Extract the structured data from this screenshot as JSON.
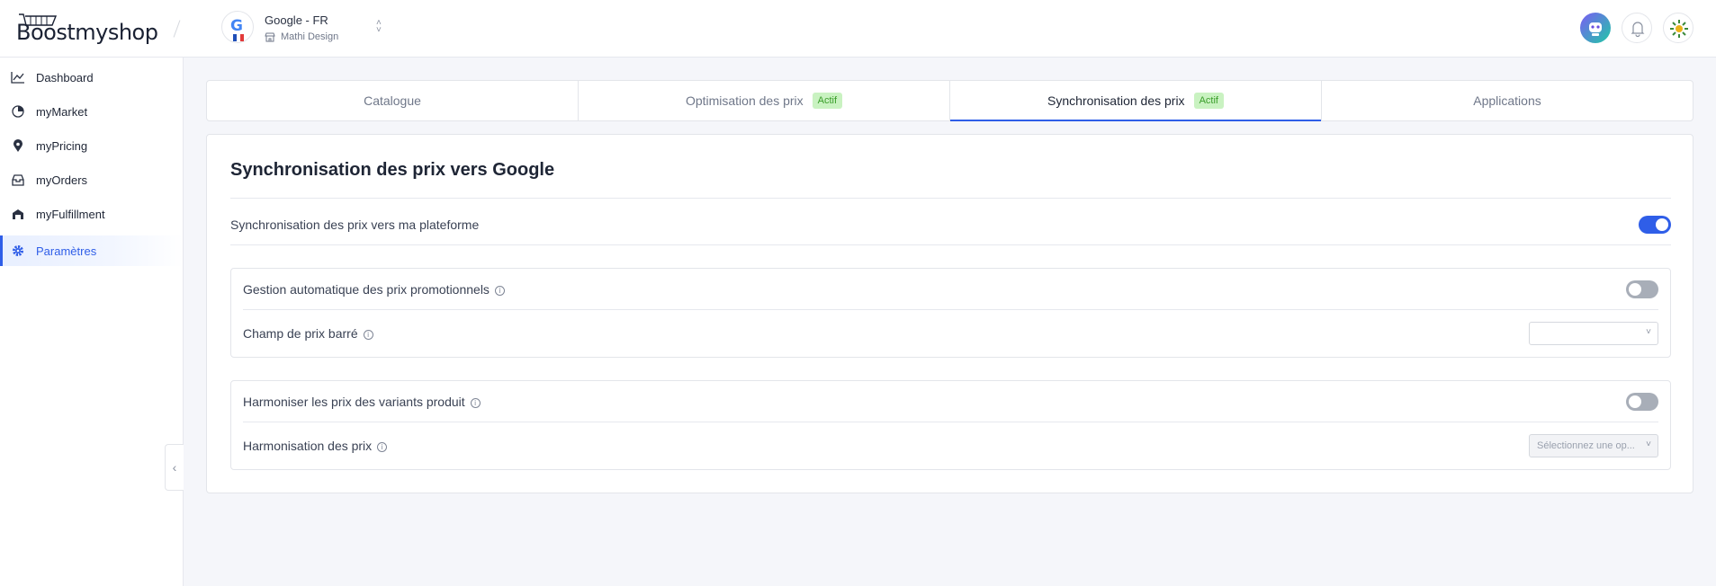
{
  "header": {
    "logo_text": "Boostmyshop",
    "account": {
      "name": "Google - FR",
      "store": "Mathi Design",
      "logo_letter": "G"
    }
  },
  "sidebar": {
    "items": [
      {
        "label": "Dashboard",
        "icon": "chart-line-icon"
      },
      {
        "label": "myMarket",
        "icon": "pie-chart-icon"
      },
      {
        "label": "myPricing",
        "icon": "price-pin-icon"
      },
      {
        "label": "myOrders",
        "icon": "inbox-icon"
      },
      {
        "label": "myFulfillment",
        "icon": "warehouse-icon"
      },
      {
        "label": "Paramètres",
        "icon": "gear-icon",
        "active": true
      }
    ]
  },
  "tabs": [
    {
      "label": "Catalogue",
      "badge": ""
    },
    {
      "label": "Optimisation des prix",
      "badge": "Actif"
    },
    {
      "label": "Synchronisation des prix",
      "badge": "Actif",
      "active": true
    },
    {
      "label": "Applications",
      "badge": ""
    }
  ],
  "main": {
    "title": "Synchronisation des prix vers Google",
    "platform_sync": {
      "label": "Synchronisation des prix vers ma plateforme",
      "enabled": true
    },
    "promo_box": {
      "auto_label": "Gestion automatique des prix promotionnels",
      "auto_enabled": false,
      "field_label": "Champ de prix barré",
      "field_value": ""
    },
    "variants_box": {
      "harmonize_label": "Harmoniser les prix des variants produit",
      "harmonize_enabled": false,
      "mode_label": "Harmonisation des prix",
      "mode_placeholder": "Sélectionnez une op..."
    }
  },
  "colors": {
    "accent": "#2f5ee8",
    "badge_bg": "#c9f2c1",
    "badge_text": "#3a9e2a",
    "toggle_off": "#a8aeb8"
  }
}
